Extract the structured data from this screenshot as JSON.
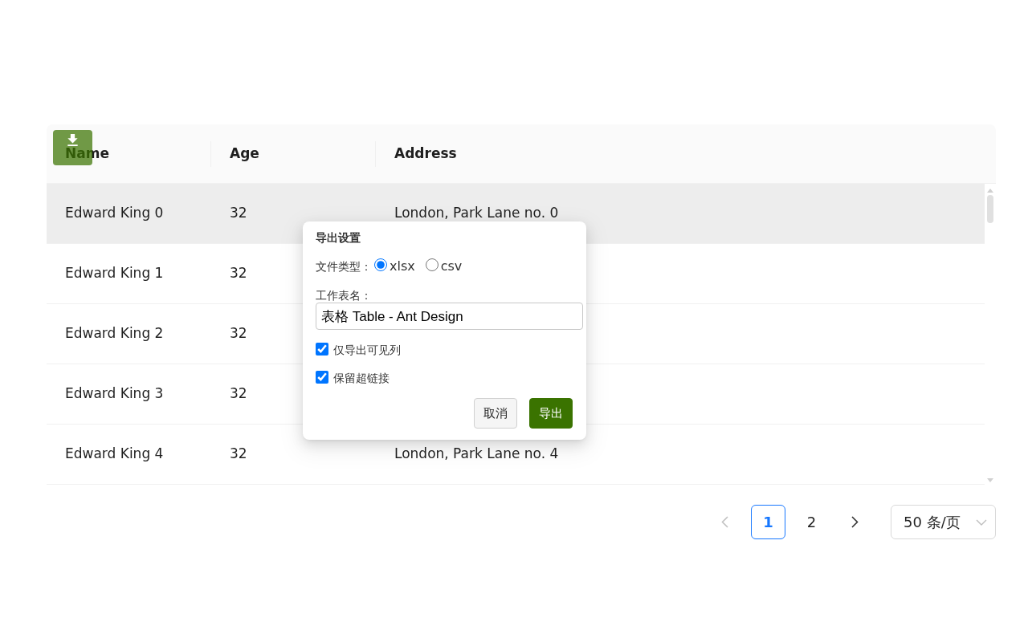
{
  "table": {
    "columns": [
      "Name",
      "Age",
      "Address"
    ],
    "rows": [
      {
        "name": "Edward King 0",
        "age": "32",
        "address": "London, Park Lane no. 0",
        "hovered": true
      },
      {
        "name": "Edward King 1",
        "age": "32",
        "hovered": false
      },
      {
        "name": "Edward King 2",
        "age": "32",
        "hovered": false
      },
      {
        "name": "Edward King 3",
        "age": "32",
        "hovered": false
      },
      {
        "name": "Edward King 4",
        "age": "32",
        "address": "London, Park Lane no. 4",
        "hovered": false
      }
    ]
  },
  "export_popup": {
    "title": "导出设置",
    "file_type_label": "文件类型：",
    "file_types": [
      {
        "label": "xlsx",
        "selected": true
      },
      {
        "label": "csv",
        "selected": false
      }
    ],
    "sheet_name_label": "工作表名：",
    "sheet_name": "表格 Table - Ant Design",
    "options": [
      {
        "label": "仅导出可见列",
        "checked": true
      },
      {
        "label": "保留超链接",
        "checked": true
      }
    ],
    "buttons": [
      {
        "label": "取消",
        "kind": "secondary"
      },
      {
        "label": "导出",
        "kind": "primary"
      }
    ]
  },
  "pagination": {
    "previous": {
      "disabled": true
    },
    "pages": [
      {
        "label": "1",
        "selected": true
      },
      {
        "label": "2",
        "selected": false
      }
    ],
    "next": {
      "disabled": false
    },
    "page_size": "50 条/页"
  }
}
